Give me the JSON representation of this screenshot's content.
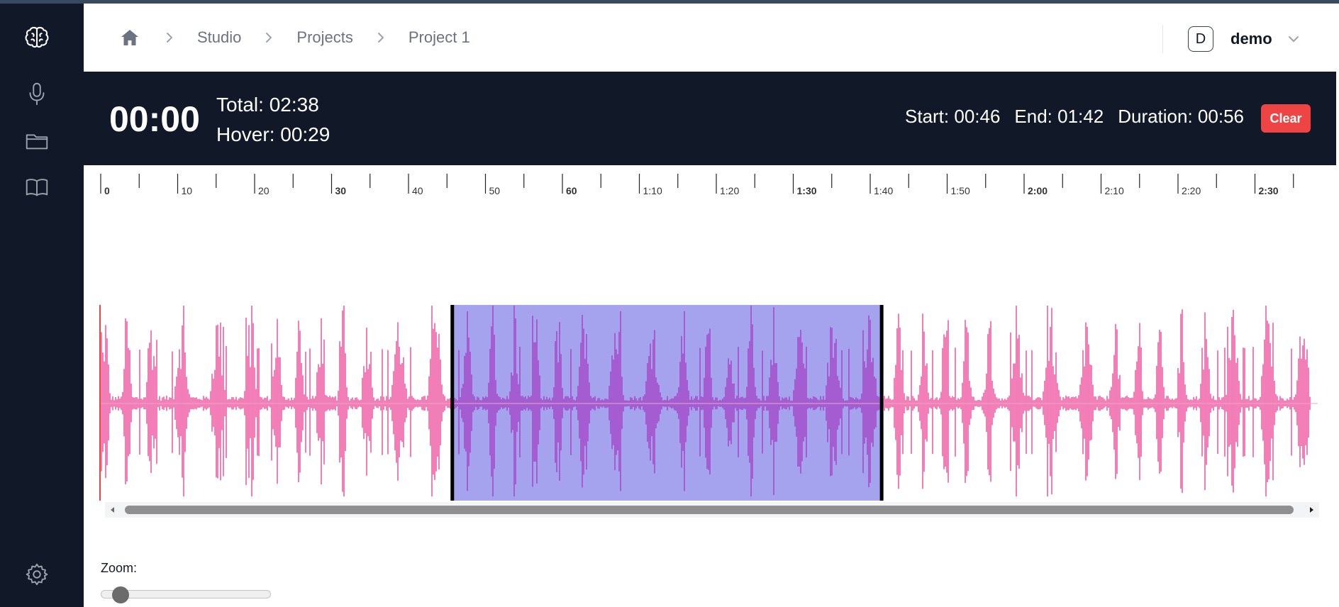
{
  "header": {
    "breadcrumbs": [
      {
        "label": "Studio"
      },
      {
        "label": "Projects"
      },
      {
        "label": "Project 1"
      }
    ],
    "user": {
      "initial": "D",
      "name": "demo"
    }
  },
  "sidebar": {
    "items": [
      {
        "name": "brain-logo-icon"
      },
      {
        "name": "microphone-icon"
      },
      {
        "name": "folder-icon"
      },
      {
        "name": "book-icon"
      },
      {
        "name": "settings-gear-icon"
      }
    ]
  },
  "player": {
    "current_time": "00:00",
    "total_text": "Total: 02:38",
    "hover_text": "Hover: 00:29",
    "start_text": "Start: 00:46",
    "end_text": "End: 01:42",
    "duration_text": "Duration: 00:56",
    "clear_label": "Clear"
  },
  "timeline": {
    "duration_seconds": 158,
    "visible_seconds": 157,
    "labels": [
      "0",
      "10",
      "20",
      "30",
      "40",
      "50",
      "60",
      "1:10",
      "1:20",
      "1:30",
      "1:40",
      "1:50",
      "2:00",
      "2:10",
      "2:20",
      "2:30"
    ],
    "bold_labels": [
      "0",
      "30",
      "60",
      "1:30",
      "2:00",
      "2:30"
    ]
  },
  "waveform": {
    "selection_start_seconds": 46,
    "selection_end_seconds": 102,
    "wave_color": "#ec4899",
    "selected_wave_color": "#a43fc4",
    "selection_fill": "#a5a3ee",
    "cursor_color": "#ef4444"
  },
  "zoom": {
    "label": "Zoom:",
    "value_fraction": 0.07
  },
  "colors": {
    "sidebar_bg": "#111827",
    "accent_red": "#ef4444"
  }
}
